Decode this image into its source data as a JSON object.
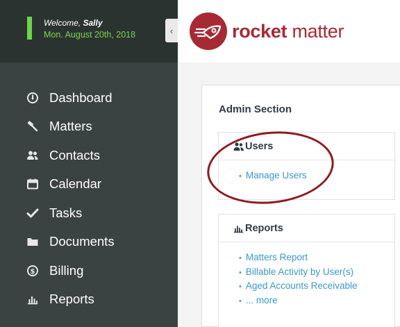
{
  "sidebar": {
    "welcome_prefix": "Welcome, ",
    "welcome_user": "Sally",
    "date": "Mon. August 20th, 2018",
    "collapse_glyph": "‹",
    "items": [
      {
        "label": "Dashboard",
        "icon": "dashboard-gauge-icon"
      },
      {
        "label": "Matters",
        "icon": "gavel-icon"
      },
      {
        "label": "Contacts",
        "icon": "contacts-people-icon"
      },
      {
        "label": "Calendar",
        "icon": "calendar-icon"
      },
      {
        "label": "Tasks",
        "icon": "checkmark-icon"
      },
      {
        "label": "Documents",
        "icon": "folder-icon"
      },
      {
        "label": "Billing",
        "icon": "dollar-circle-icon"
      },
      {
        "label": "Reports",
        "icon": "bar-chart-icon"
      }
    ]
  },
  "header": {
    "logo_word1": "rocket",
    "logo_word2": " matter",
    "brand_color": "#a52a34"
  },
  "main": {
    "section_title": "Admin Section",
    "users_box": {
      "title": "Users",
      "links": [
        "Manage Users"
      ]
    },
    "reports_box": {
      "title": "Reports",
      "links": [
        "Matters Report",
        "Billable Activity by User(s)",
        "Aged Accounts Receivable",
        "... more"
      ]
    },
    "link_color": "#3a98c9",
    "highlight_color": "#8d1b22"
  }
}
